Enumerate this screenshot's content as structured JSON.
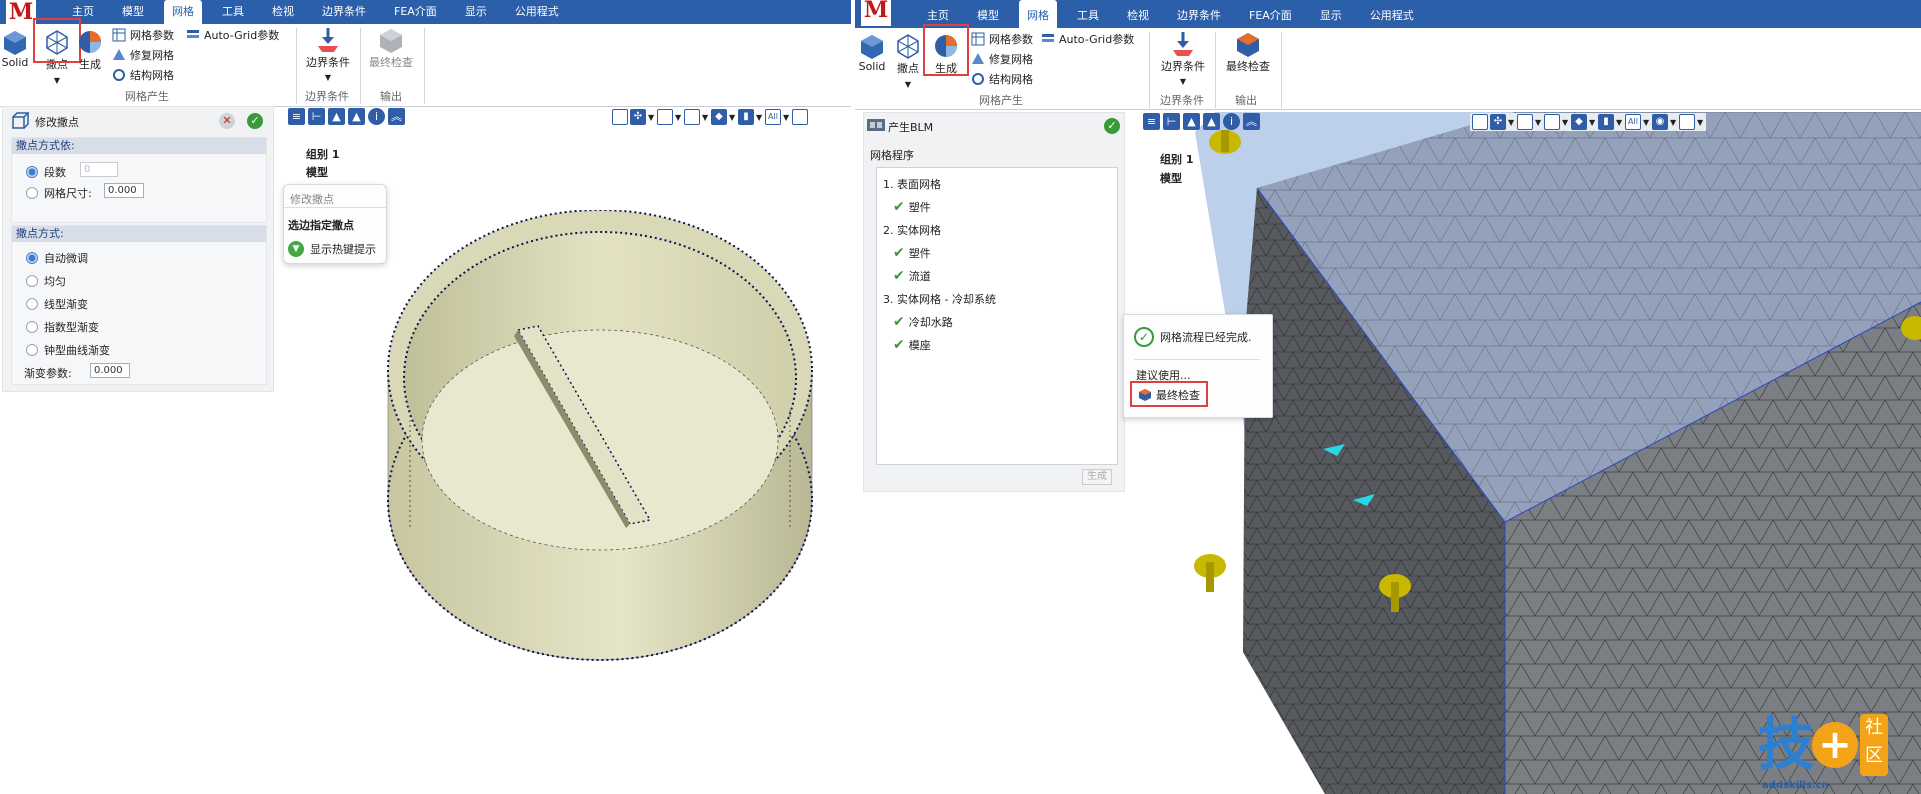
{
  "colors": {
    "tab_bar": "#2b5faa",
    "logo_red": "#c01818",
    "highlight_red": "#e04040",
    "model_yellow": "#d7d6b5",
    "mesh_gray": "#7a7d82",
    "mesh_blue": "#a7c1e5",
    "check_green": "#3a9a3a"
  },
  "left": {
    "logo": "M",
    "tabs": [
      "主页",
      "模型",
      "网格",
      "工具",
      "检视",
      "边界条件",
      "FEA介面",
      "显示",
      "公用程式"
    ],
    "active_tab": "网格",
    "ribbon": {
      "solid": "Solid",
      "seed": "撒点",
      "generate": "生成",
      "mesh_params": "网格参数",
      "repair_mesh": "修复网格",
      "struct_mesh": "结构网格",
      "autogrid": "Auto-Grid参数",
      "boundary": "边界条件",
      "final_check": "最终检查",
      "group_mesh": "网格产生",
      "group_boundary": "边界条件",
      "group_output": "输出"
    },
    "panel": {
      "title": "修改撒点",
      "section1": "撒点方式依:",
      "opt_segments": "段数",
      "seg_value": "0",
      "opt_mesh_size": "网格尺寸:",
      "mesh_size_value": "0.000",
      "section2": "撒点方式:",
      "methods": [
        "自动微调",
        "均匀",
        "线型渐变",
        "指数型渐变",
        "钟型曲线渐变"
      ],
      "gradient_label": "渐变参数:",
      "gradient_value": "0.000"
    },
    "popup": {
      "header": "修改撒点",
      "item1": "选边指定撒点",
      "item2": "显示热键提示"
    },
    "viewport": {
      "group_label": "组别 1",
      "model_label": "模型",
      "all_label": "All"
    }
  },
  "right": {
    "logo": "M",
    "tabs": [
      "主页",
      "模型",
      "网格",
      "工具",
      "检视",
      "边界条件",
      "FEA介面",
      "显示",
      "公用程式"
    ],
    "active_tab": "网格",
    "ribbon": {
      "solid": "Solid",
      "seed": "撒点",
      "generate": "生成",
      "mesh_params": "网格参数",
      "repair_mesh": "修复网格",
      "struct_mesh": "结构网格",
      "autogrid": "Auto-Grid参数",
      "boundary": "边界条件",
      "final_check": "最终检查",
      "group_mesh": "网格产生",
      "group_boundary": "边界条件",
      "group_output": "输出"
    },
    "panel": {
      "title": "产生BLM",
      "subtitle": "网格程序",
      "step1": "1. 表面网格",
      "step1_a": "塑件",
      "step2": "2. 实体网格",
      "step2_a": "塑件",
      "step2_b": "流道",
      "step3": "3. 实体网格 - 冷却系统",
      "step3_a": "冷却水路",
      "step3_b": "模座",
      "generate_btn": "生成"
    },
    "popup": {
      "message": "网格流程已经完成.",
      "suggest": "建议使用...",
      "action": "最终检查"
    },
    "viewport": {
      "group_label": "组别 1",
      "model_label": "模型",
      "all_label": "All"
    }
  },
  "watermark": {
    "main": "技",
    "badge_1": "社",
    "badge_2": "区",
    "url": "addskills.cn"
  }
}
